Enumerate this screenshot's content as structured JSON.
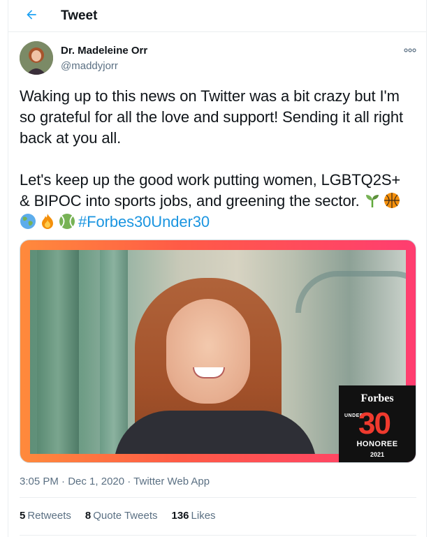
{
  "header": {
    "title": "Tweet",
    "back_icon": "arrow-left-icon",
    "accent": "#1da1f2"
  },
  "author": {
    "name": "Dr. Madeleine Orr",
    "handle": "@maddyjorr"
  },
  "tweet": {
    "paragraph1": "Waking up to this news on Twitter was a bit crazy but I'm so grateful for all the love and support! Sending it all right back at you all.",
    "paragraph2_line1": "Let's keep up the good work putting women, LGBTQ2S+",
    "paragraph2_line2": "& BIPOC into sports jobs, and greening the sector. ",
    "hashtag": "#Forbes30Under30",
    "emojis": [
      "seedling-emoji",
      "basketball-emoji",
      "globe-emoji",
      "fire-emoji",
      "tennis-ball-emoji"
    ],
    "hashtag_color": "#1b95e0"
  },
  "media": {
    "badge_brand": "Forbes",
    "badge_under": "UNDER",
    "badge_number": "30",
    "badge_honoree": "HONOREE",
    "badge_year": "2021"
  },
  "meta": {
    "time": "3:05 PM",
    "separator1": " · ",
    "date": "Dec 1, 2020",
    "separator2": " · ",
    "source": "Twitter Web App"
  },
  "stats": {
    "retweets_count": "5",
    "retweets_label": "Retweets",
    "quotes_count": "8",
    "quotes_label": "Quote Tweets",
    "likes_count": "136",
    "likes_label": "Likes"
  }
}
